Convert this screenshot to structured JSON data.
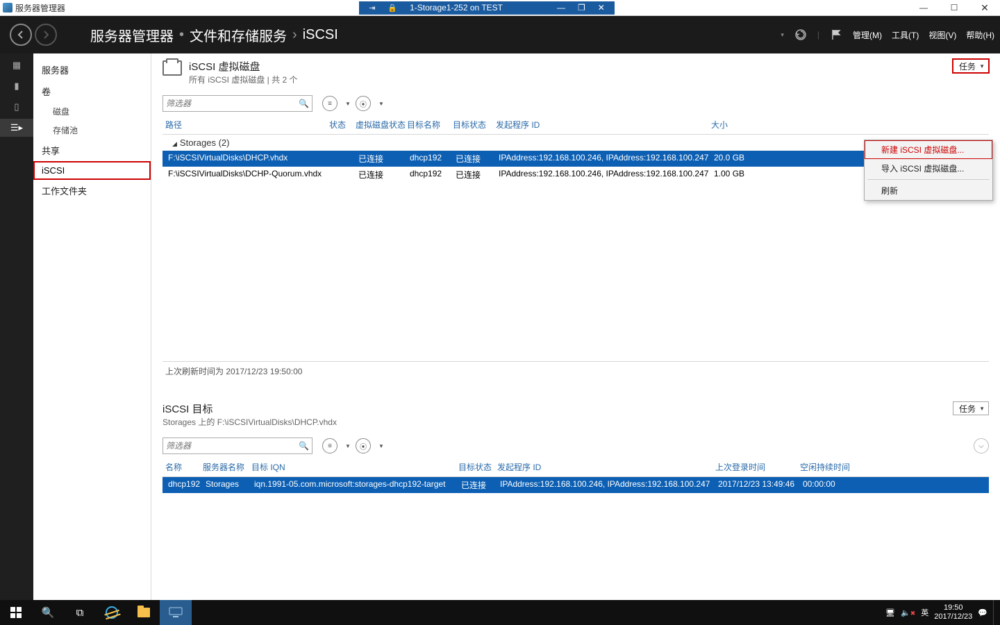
{
  "outerWindow": {
    "title": "服务器管理器",
    "vmLabel": "1-Storage1-252 on TEST"
  },
  "header": {
    "breadcrumb": [
      "服务器管理器",
      "文件和存储服务",
      "iSCSI"
    ],
    "menu": {
      "manage": "管理(M)",
      "tools": "工具(T)",
      "view": "视图(V)",
      "help": "帮助(H)"
    }
  },
  "sidebar": {
    "items": [
      {
        "label": "服务器",
        "sub": false
      },
      {
        "label": "卷",
        "sub": false
      },
      {
        "label": "磁盘",
        "sub": true
      },
      {
        "label": "存储池",
        "sub": true
      },
      {
        "label": "共享",
        "sub": false
      },
      {
        "label": "iSCSI",
        "sub": false,
        "selected": true
      },
      {
        "label": "工作文件夹",
        "sub": false
      }
    ]
  },
  "disksPanel": {
    "title": "iSCSI 虚拟磁盘",
    "sub": "所有 iSCSI 虚拟磁盘 | 共 2 个",
    "tasks": "任务",
    "filterPlaceholder": "筛选器",
    "columns": {
      "path": "路径",
      "status": "状态",
      "vstatus": "虚拟磁盘状态",
      "tname": "目标名称",
      "tstatus": "目标状态",
      "iid": "发起程序 ID",
      "size": "大小"
    },
    "group": "Storages (2)",
    "rows": [
      {
        "path": "F:\\iSCSIVirtualDisks\\DHCP.vhdx",
        "vstatus": "已连接",
        "tname": "dhcp192",
        "tstatus": "已连接",
        "iid": "IPAddress:192.168.100.246, IPAddress:192.168.100.247",
        "size": "20.0 GB"
      },
      {
        "path": "F:\\iSCSIVirtualDisks\\DCHP-Quorum.vhdx",
        "vstatus": "已连接",
        "tname": "dhcp192",
        "tstatus": "已连接",
        "iid": "IPAddress:192.168.100.246, IPAddress:192.168.100.247",
        "size": "1.00 GB"
      }
    ],
    "statusLine": "上次刷新时间为 2017/12/23 19:50:00"
  },
  "contextMenu": {
    "new": "新建 iSCSI 虚拟磁盘...",
    "import": "导入 iSCSI 虚拟磁盘...",
    "refresh": "刷新"
  },
  "targetsPanel": {
    "title": "iSCSI 目标",
    "sub": "Storages 上的 F:\\iSCSIVirtualDisks\\DHCP.vhdx",
    "tasks": "任务",
    "filterPlaceholder": "筛选器",
    "columns": {
      "name": "名称",
      "srv": "服务器名称",
      "iqn": "目标 IQN",
      "tstat": "目标状态",
      "iid": "发起程序 ID",
      "last": "上次登录时间",
      "idle": "空闲持续时间"
    },
    "rows": [
      {
        "name": "dhcp192",
        "srv": "Storages",
        "iqn": "iqn.1991-05.com.microsoft:storages-dhcp192-target",
        "tstat": "已连接",
        "iid": "IPAddress:192.168.100.246, IPAddress:192.168.100.247",
        "last": "2017/12/23 13:49:46",
        "idle": "00:00:00"
      }
    ]
  },
  "taskbar": {
    "time": "19:50",
    "date": "2017/12/23",
    "ime": "英"
  }
}
